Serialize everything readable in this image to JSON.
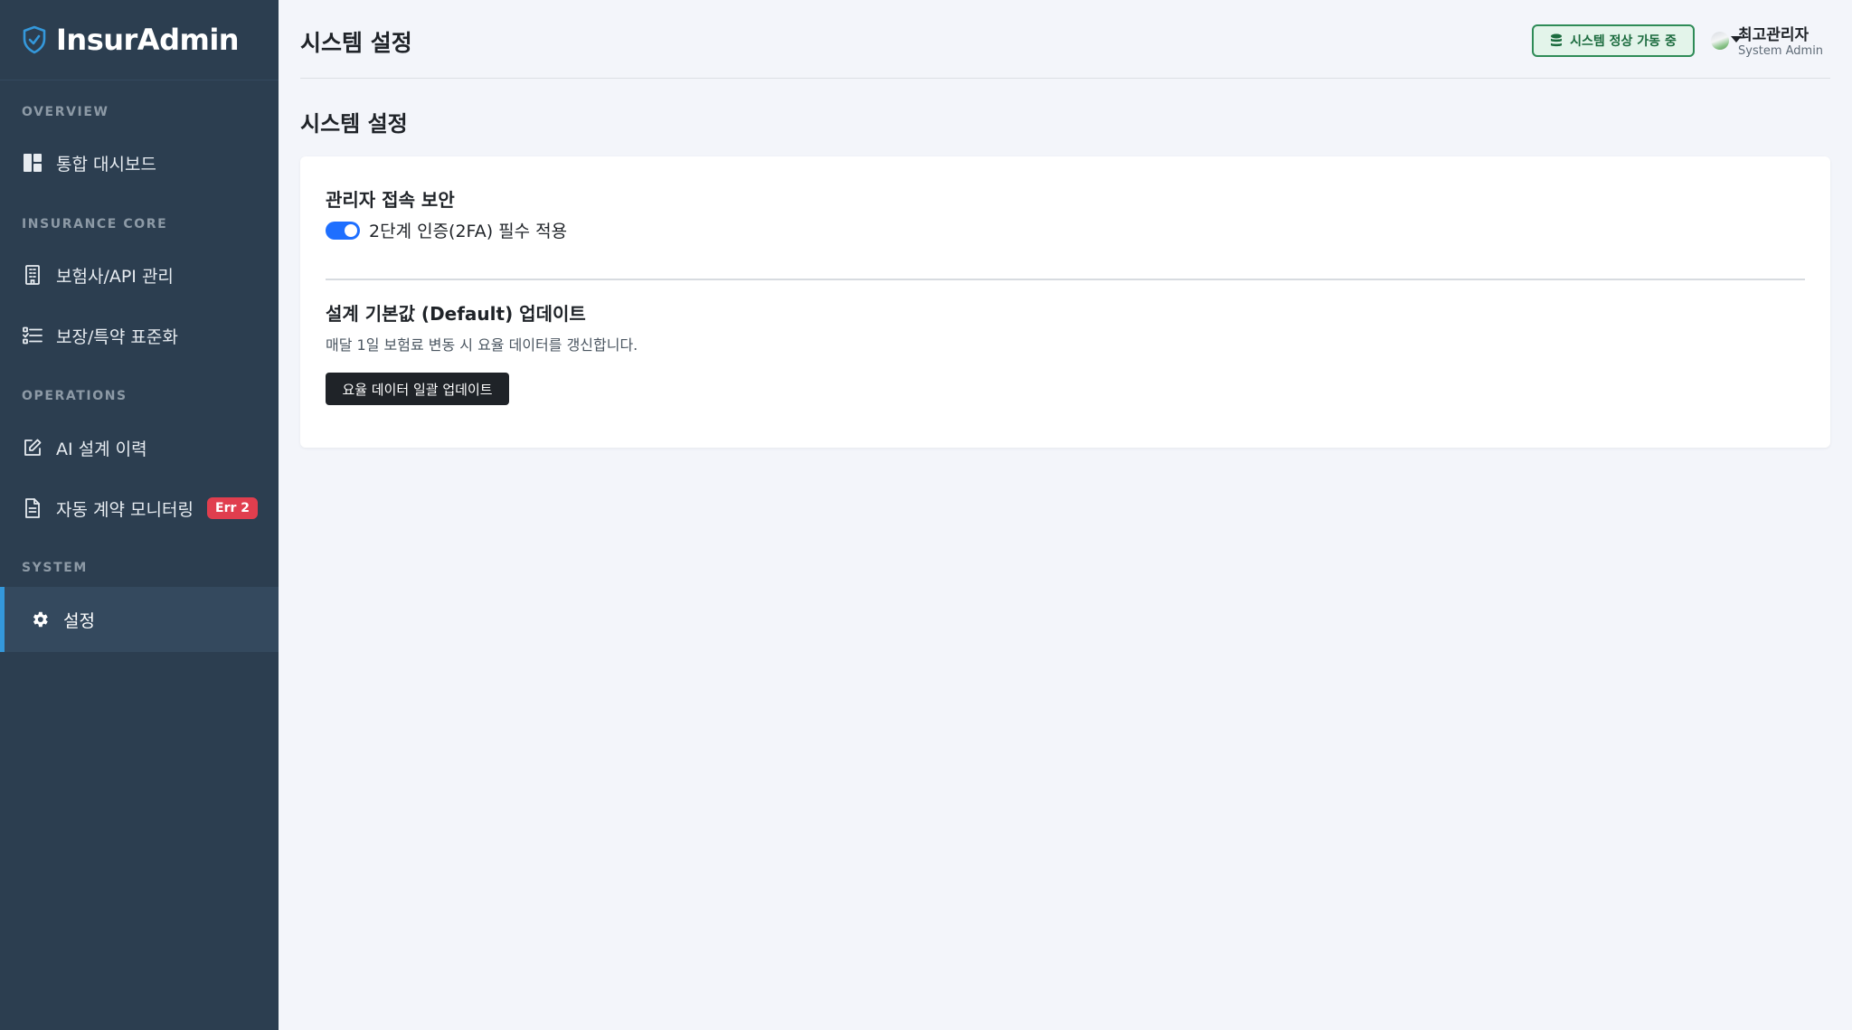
{
  "brand": {
    "name": "InsurAdmin",
    "icon": "shield-icon"
  },
  "sidebar": {
    "sections": [
      {
        "label": "OVERVIEW"
      },
      {
        "label": "INSURANCE CORE"
      },
      {
        "label": "OPERATIONS"
      },
      {
        "label": "SYSTEM"
      }
    ],
    "items": [
      {
        "label": "통합 대시보드",
        "icon": "dashboard-icon"
      },
      {
        "label": "보험사/API 관리",
        "icon": "building-icon"
      },
      {
        "label": "보장/특약 표준화",
        "icon": "checklist-icon"
      },
      {
        "label": "AI 설계 이력",
        "icon": "edit-icon"
      },
      {
        "label": "자동 계약 모니터링",
        "icon": "document-icon",
        "badge": "Err 2"
      },
      {
        "label": "설정",
        "icon": "gear-icon",
        "active": true
      }
    ]
  },
  "header": {
    "title": "시스템 설정",
    "status": "시스템 정상 가동 중",
    "status_color": "#2e8b57",
    "user": {
      "name": "최고관리자",
      "role": "System Admin"
    }
  },
  "main": {
    "title": "시스템 설정",
    "security": {
      "title": "관리자 접속 보안",
      "toggle_label": "2단계 인증(2FA) 필수 적용",
      "toggle_on": true
    },
    "defaults": {
      "title": "설계 기본값 (Default) 업데이트",
      "description": "매달 1일 보험료 변동 시 요율 데이터를 갱신합니다.",
      "button_label": "요율 데이터 일괄 업데이트"
    }
  },
  "colors": {
    "sidebar_bg": "#2c3e50",
    "accent": "#3498db",
    "toggle": "#1e6fff",
    "badge": "#e03e4e"
  }
}
